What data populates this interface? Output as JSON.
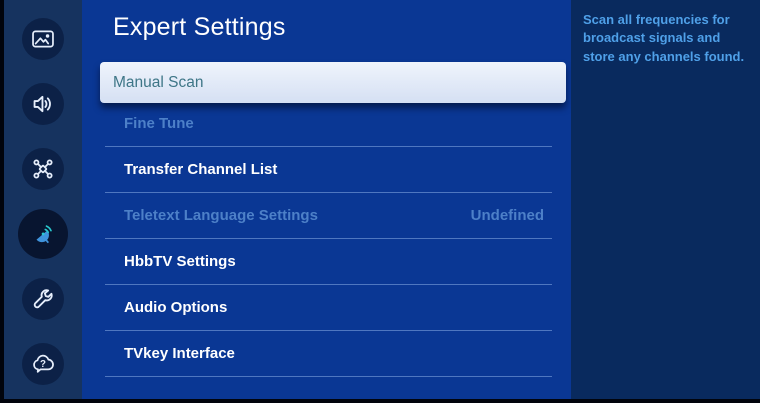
{
  "app": {
    "title": "Expert Settings"
  },
  "sidebar": {
    "items": [
      {
        "name": "picture",
        "icon": "picture-icon",
        "active": false
      },
      {
        "name": "sound",
        "icon": "sound-icon",
        "active": false
      },
      {
        "name": "connection",
        "icon": "connection-icon",
        "active": false
      },
      {
        "name": "broadcasting",
        "icon": "satellite-dish-icon",
        "active": true
      },
      {
        "name": "general",
        "icon": "wrench-icon",
        "active": false
      },
      {
        "name": "support",
        "icon": "support-cloud-icon",
        "active": false
      }
    ]
  },
  "main": {
    "title": "Expert Settings",
    "focused_item": {
      "label": "Manual Scan",
      "selected": true
    },
    "items": [
      {
        "label": "Fine Tune",
        "enabled": false,
        "value": ""
      },
      {
        "label": "Transfer Channel List",
        "enabled": true,
        "value": ""
      },
      {
        "label": "Teletext Language Settings",
        "enabled": false,
        "value": "Undefined"
      },
      {
        "label": "HbbTV Settings",
        "enabled": true,
        "value": ""
      },
      {
        "label": "Audio Options",
        "enabled": true,
        "value": ""
      },
      {
        "label": "TVkey Interface",
        "enabled": true,
        "value": ""
      }
    ]
  },
  "info_panel": {
    "description": "Scan all frequencies for broadcast signals and store any channels found."
  },
  "colors": {
    "main_bg": "#0a3794",
    "sidebar_bg": "#16335f",
    "panel_bg": "#092a5e",
    "icon_circle_bg": "#0c2147",
    "active_icon_teal": "#29c9cf",
    "active_icon_blue": "#3f93dc",
    "highlight_row_bg": "#dfe8f7",
    "highlight_text": "#3e7687",
    "enabled_text": "#ffffff",
    "disabled_text": "#4d80c8",
    "info_text": "#4fa0e8"
  }
}
